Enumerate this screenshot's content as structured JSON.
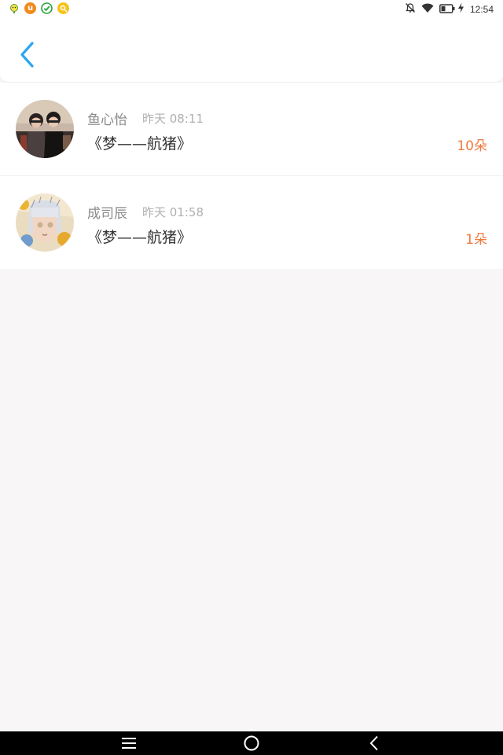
{
  "status_bar": {
    "time": "12:54",
    "left_icons": [
      "chat-app-icon",
      "u-app-icon",
      "check-app-icon",
      "yellow-app-icon"
    ],
    "right_icons": [
      "notifications-off-icon",
      "wifi-icon",
      "battery-icon",
      "charging-icon"
    ]
  },
  "header": {
    "back_icon": "chevron-left-icon",
    "accent_color": "#2aa7ee"
  },
  "list": [
    {
      "name": "鱼心怡",
      "time": "昨天 08:11",
      "title": "《梦——航猪》",
      "count": "10朵"
    },
    {
      "name": "成司辰",
      "time": "昨天 01:58",
      "title": "《梦——航猪》",
      "count": "1朵"
    }
  ],
  "colors": {
    "count": "#f07b3f",
    "background": "#f8f6f7"
  },
  "nav_bar": {
    "icons": [
      "menu-icon",
      "home-icon",
      "back-icon"
    ]
  }
}
